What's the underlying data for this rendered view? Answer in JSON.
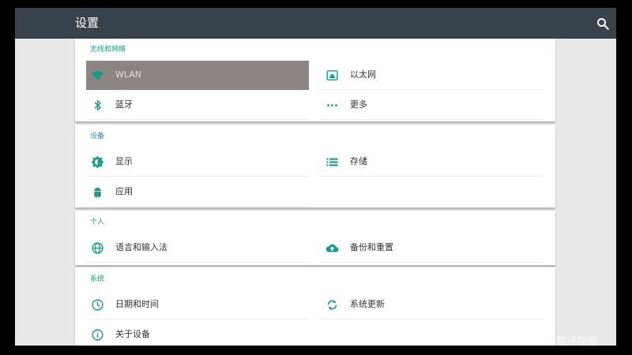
{
  "header": {
    "title": "设置",
    "search_icon": "search-icon"
  },
  "accent_color": "#1a9b8a",
  "sections": [
    {
      "title": "无线和网络",
      "items": [
        {
          "label": "WLAN",
          "icon": "wifi-icon",
          "selected": true
        },
        {
          "label": "以太网",
          "icon": "ethernet-icon"
        },
        {
          "label": "蓝牙",
          "icon": "bluetooth-icon"
        },
        {
          "label": "更多",
          "icon": "more-dots-icon"
        }
      ]
    },
    {
      "title": "设备",
      "items": [
        {
          "label": "显示",
          "icon": "brightness-icon"
        },
        {
          "label": "存储",
          "icon": "storage-list-icon"
        },
        {
          "label": "应用",
          "icon": "android-icon"
        }
      ]
    },
    {
      "title": "个人",
      "items": [
        {
          "label": "语言和输入法",
          "icon": "globe-icon"
        },
        {
          "label": "备份和重置",
          "icon": "cloud-upload-icon"
        }
      ]
    },
    {
      "title": "系统",
      "items": [
        {
          "label": "日期和时间",
          "icon": "clock-icon"
        },
        {
          "label": "系统更新",
          "icon": "sync-icon"
        },
        {
          "label": "关于设备",
          "icon": "info-icon"
        }
      ]
    }
  ],
  "watermark": "头条号 / 评酷评视图"
}
